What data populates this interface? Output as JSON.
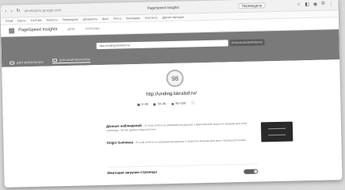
{
  "browser": {
    "url": "developers.google.com",
    "tab_title": "PageSpeed Insights",
    "lang_button": "Переведено"
  },
  "bookmarks": [
    "Gmail",
    "Карты",
    "YouTube",
    "Новости",
    "Переводчик",
    "Документы",
    "Диск",
    "Почта",
    "Календарь",
    "Контакты",
    "Другие закладки"
  ],
  "app": {
    "title": "PageSpeed Insights",
    "nav_home": "ДОМ",
    "nav_docs": "ПОМОЩЬ"
  },
  "hero": {
    "url_value": "http://unding.lskralsd.ru/",
    "analyze_label": "ПРОАНАЛИЗИРОВАТЬ",
    "tab_mobile": "ДЛЯ МОБИЛЬНЫХ",
    "tab_desktop": "ДЛЯ КОМПЬЮТЕРОВ"
  },
  "score": {
    "value": "98",
    "tested_url": "http://unding.lskralsd.ru/",
    "legend": [
      "0–49",
      "50–89",
      "90–100"
    ]
  },
  "field_data": {
    "title": "Данные наблюдений",
    "text": "– В этом отчёте не указываются данные о фактической скорости загрузки для этой страницы, так как данных недостаточно."
  },
  "origin_summary": {
    "title": "Origin Summary",
    "text": "– В этом отчёте не указываются данные о скорости загрузки для всех страниц источника."
  },
  "lab_data": {
    "title": "Имитация загрузки страницы"
  }
}
